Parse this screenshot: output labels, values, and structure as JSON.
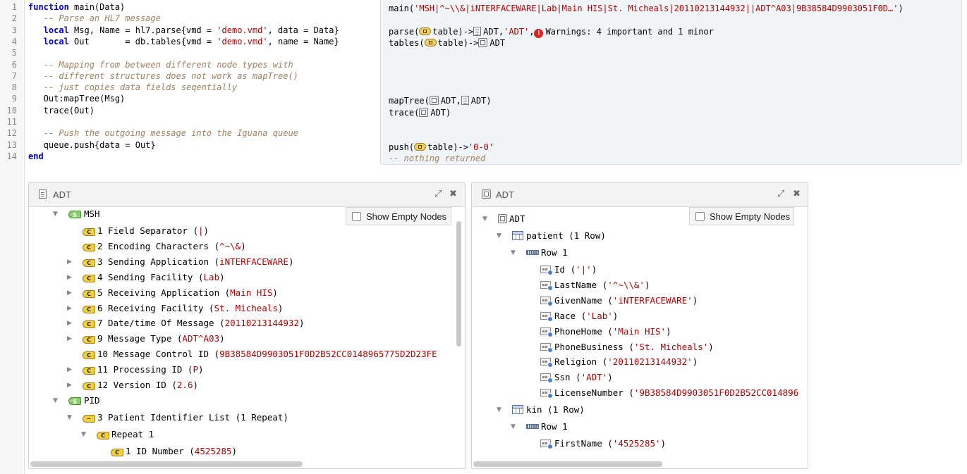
{
  "editor": {
    "line_numbers": [
      "1",
      "2",
      "3",
      "4",
      "5",
      "6",
      "7",
      "8",
      "9",
      "10",
      "11",
      "12",
      "13",
      "14"
    ],
    "lines": [
      [
        {
          "t": "kw",
          "v": "function"
        },
        {
          "t": "",
          "v": " main(Data)"
        }
      ],
      [
        {
          "t": "cm",
          "v": "   -- Parse an HL7 message"
        }
      ],
      [
        {
          "t": "kw",
          "v": "   local"
        },
        {
          "t": "",
          "v": " Msg, Name = hl7.parse{vmd = "
        },
        {
          "t": "st",
          "v": "'demo.vmd'"
        },
        {
          "t": "",
          "v": ", data = Data}"
        }
      ],
      [
        {
          "t": "kw",
          "v": "   local"
        },
        {
          "t": "",
          "v": " Out       = db.tables{vmd = "
        },
        {
          "t": "st",
          "v": "'demo.vmd'"
        },
        {
          "t": "",
          "v": ", name = Name}"
        }
      ],
      [
        {
          "t": "",
          "v": ""
        }
      ],
      [
        {
          "t": "cm",
          "v": "   -- Mapping from between different node types with"
        }
      ],
      [
        {
          "t": "cm",
          "v": "   -- different structures does not work as mapTree()"
        }
      ],
      [
        {
          "t": "cm",
          "v": "   -- just copies data fields seqentially"
        }
      ],
      [
        {
          "t": "",
          "v": "   Out:mapTree(Msg)"
        }
      ],
      [
        {
          "t": "",
          "v": "   trace(Out)"
        }
      ],
      [
        {
          "t": "",
          "v": ""
        }
      ],
      [
        {
          "t": "cm",
          "v": "   -- Push the outgoing message into the Iguana queue"
        }
      ],
      [
        {
          "t": "",
          "v": "   queue.push{data = Out}"
        }
      ],
      [
        {
          "t": "kw",
          "v": "end"
        }
      ]
    ]
  },
  "annotations": {
    "main_prefix": "main(",
    "main_arg": "'MSH|^~\\\\&|iNTERFACEWARE|Lab|Main HIS|St. Micheals|20110213144932||ADT^A03|9B38584D9903051F0D…'",
    "main_suffix": ")",
    "parse_prefix": "parse(",
    "table": "table",
    "arrow": ")->",
    "adt": "ADT",
    "adt_str": "'ADT'",
    "comma": ",",
    "warnings": "Warnings: 4 important and 1 minor",
    "tables_prefix": "tables(",
    "maptree_prefix": "mapTree(",
    "close": ")",
    "trace_prefix": "trace(",
    "push_prefix": "push(",
    "push_result": "'0-0'",
    "nothing": "-- nothing returned"
  },
  "left_panel": {
    "title": "ADT",
    "show_empty_nodes": "Show Empty Nodes",
    "icons": {
      "header": "document-icon",
      "segment": "segment-icon",
      "field": "field-icon"
    },
    "segment_msh": "MSH",
    "fields": [
      {
        "label": "1 Field Separator (",
        "value": "|",
        "close": ")",
        "expand": false
      },
      {
        "label": "2 Encoding Characters (",
        "value": "^~\\&",
        "close": ")",
        "expand": false
      },
      {
        "label": "3 Sending Application (",
        "value": "iNTERFACEWARE",
        "close": ")",
        "expand": true
      },
      {
        "label": "4 Sending Facility (",
        "value": "Lab",
        "close": ")",
        "expand": true
      },
      {
        "label": "5 Receiving Application (",
        "value": "Main HIS",
        "close": ")",
        "expand": true
      },
      {
        "label": "6 Receiving Facility (",
        "value": "St. Micheals",
        "close": ")",
        "expand": true
      },
      {
        "label": "7 Date/time Of Message (",
        "value": "20110213144932",
        "close": ")",
        "expand": true
      },
      {
        "label": "9 Message Type (",
        "value": "ADT^A03",
        "close": ")",
        "expand": true
      },
      {
        "label": "10 Message Control ID (",
        "value": "9B38584D9903051F0D2B52CC0148965775D2D23FE",
        "close": "",
        "expand": false
      },
      {
        "label": "11 Processing ID (",
        "value": "P",
        "close": ")",
        "expand": true
      },
      {
        "label": "12 Version ID (",
        "value": "2.6",
        "close": ")",
        "expand": true
      }
    ],
    "segment_pid": "PID",
    "pid_field": "3 Patient Identifier List (1 Repeat)",
    "repeat": "Repeat 1",
    "id_number_label": "1 ID Number (",
    "id_number_value": "4525285",
    "id_number_close": ")"
  },
  "right_panel": {
    "title": "ADT",
    "show_empty_nodes": "Show Empty Nodes",
    "root": "ADT",
    "patient": "patient (1 Row)",
    "row1": "Row 1",
    "columns": [
      {
        "label": "Id (",
        "value": "'|'",
        "close": ")"
      },
      {
        "label": "LastName (",
        "value": "'^~\\\\&'",
        "close": ")"
      },
      {
        "label": "GivenName (",
        "value": "'iNTERFACEWARE'",
        "close": ")"
      },
      {
        "label": "Race (",
        "value": "'Lab'",
        "close": ")"
      },
      {
        "label": "PhoneHome (",
        "value": "'Main HIS'",
        "close": ")"
      },
      {
        "label": "PhoneBusiness (",
        "value": "'St. Micheals'",
        "close": ")"
      },
      {
        "label": "Religion (",
        "value": "'20110213144932'",
        "close": ")"
      },
      {
        "label": "Ssn (",
        "value": "'ADT'",
        "close": ")"
      },
      {
        "label": "LicenseNumber (",
        "value": "'9B38584D9903051F0D2B52CC014896",
        "close": ""
      }
    ],
    "kin": "kin (1 Row)",
    "kin_row": "Row 1",
    "kin_first_label": "FirstName (",
    "kin_first_value": "'4525285'",
    "kin_first_close": ")"
  },
  "colors": {
    "keyword": "#0000c0",
    "comment": "#a08060",
    "string": "#b00000",
    "annotation_bg": "#f2f5f8"
  }
}
